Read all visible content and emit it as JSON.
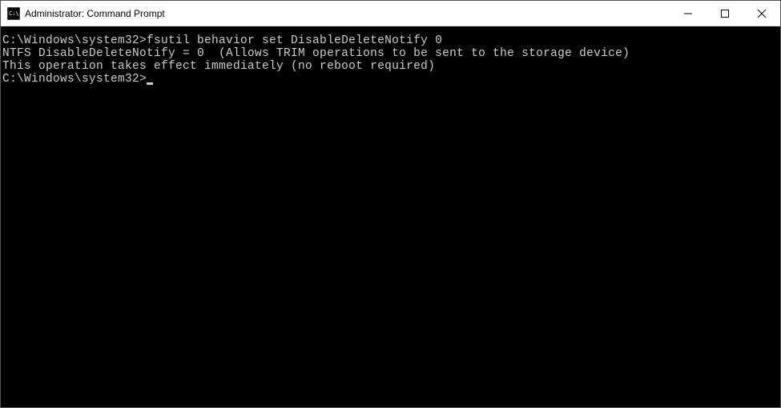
{
  "window": {
    "title": "Administrator: Command Prompt"
  },
  "terminal": {
    "lines": [
      "C:\\Windows\\system32>fsutil behavior set DisableDeleteNotify 0",
      "NTFS DisableDeleteNotify = 0  (Allows TRIM operations to be sent to the storage device)",
      "",
      "This operation takes effect immediately (no reboot required)",
      "",
      "C:\\Windows\\system32>"
    ]
  }
}
